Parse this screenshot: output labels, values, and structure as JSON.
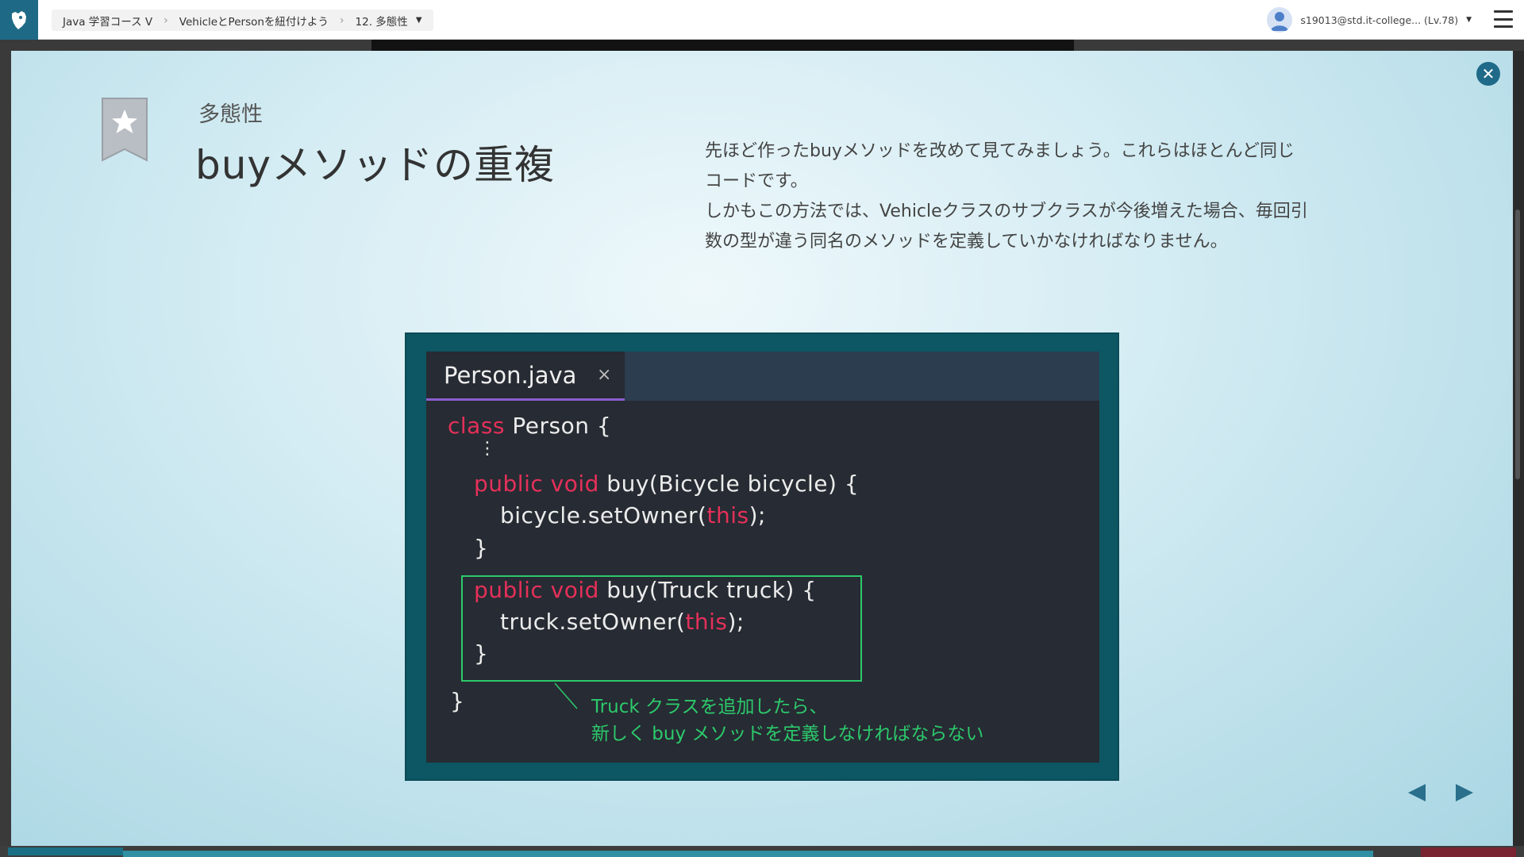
{
  "topbar": {
    "breadcrumb": [
      {
        "label": "Java 学習コース V"
      },
      {
        "label": "VehicleとPersonを紐付けよう"
      },
      {
        "label": "12. 多態性"
      }
    ],
    "user": {
      "name": "s19013@std.it-college... (Lv.78)"
    }
  },
  "slide": {
    "subtitle": "多態性",
    "title": "buyメソッドの重複",
    "description": [
      "先ほど作ったbuyメソッドを改めて見てみましょう。これらはほとんど同じ",
      "コードです。",
      "しかもこの方法では、Vehicleクラスのサブクラスが今後増えた場合、毎回引",
      "数の型が違う同名のメソッドを定義していかなければなりません。"
    ],
    "code_window": {
      "tab_name": "Person.java",
      "tab_close": "×",
      "lines": {
        "l1_kw": "class",
        "l1_rest": " Person {",
        "l2": "⋮",
        "l3_kw": "public void",
        "l3_rest": " buy(Bicycle bicycle) {",
        "l4_a": "bicycle.setOwner(",
        "l4_kw": "this",
        "l4_b": ");",
        "l5": "}",
        "l6_kw": "public void",
        "l6_rest": " buy(Truck truck) {",
        "l7_a": "truck.setOwner(",
        "l7_kw": "this",
        "l7_b": ");",
        "l8": "}",
        "l9": "}"
      },
      "note": [
        "Truck クラスを追加したら、",
        "新しく buy メソッドを定義しなければならない"
      ]
    }
  },
  "colors": {
    "accent": "#1f6a88",
    "keyword": "#e5305a",
    "highlight": "#2cc96c",
    "tab_underline": "#8b5ecf"
  }
}
